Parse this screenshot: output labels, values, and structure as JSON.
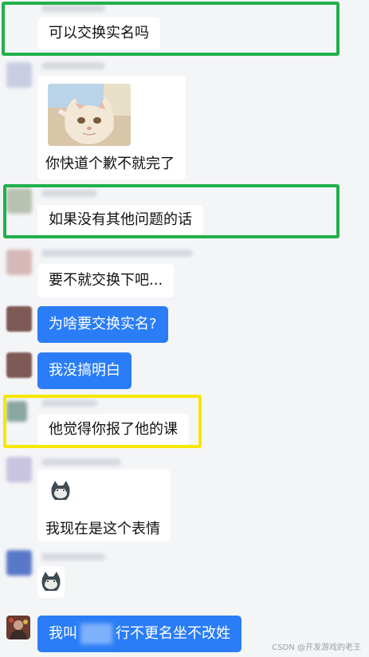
{
  "messages": [
    {
      "text": "可以交换实名吗"
    },
    {
      "text": "你快道个歉不就完了"
    },
    {
      "text": "如果没有其他问题的话"
    },
    {
      "text": "要不就交换下吧..."
    },
    {
      "text": "为啥要交换实名?"
    },
    {
      "text": "我没搞明白"
    },
    {
      "text": "他觉得你报了他的课"
    },
    {
      "text": "我现在是这个表情"
    },
    {
      "text_before": "我叫",
      "text_after": "行不更名坐不改姓"
    }
  ],
  "watermark": "CSDN @开发游戏的老王",
  "colors": {
    "self_bubble": "#2a7df6",
    "highlight_green": "#21b04b",
    "highlight_yellow": "#f7e600"
  }
}
